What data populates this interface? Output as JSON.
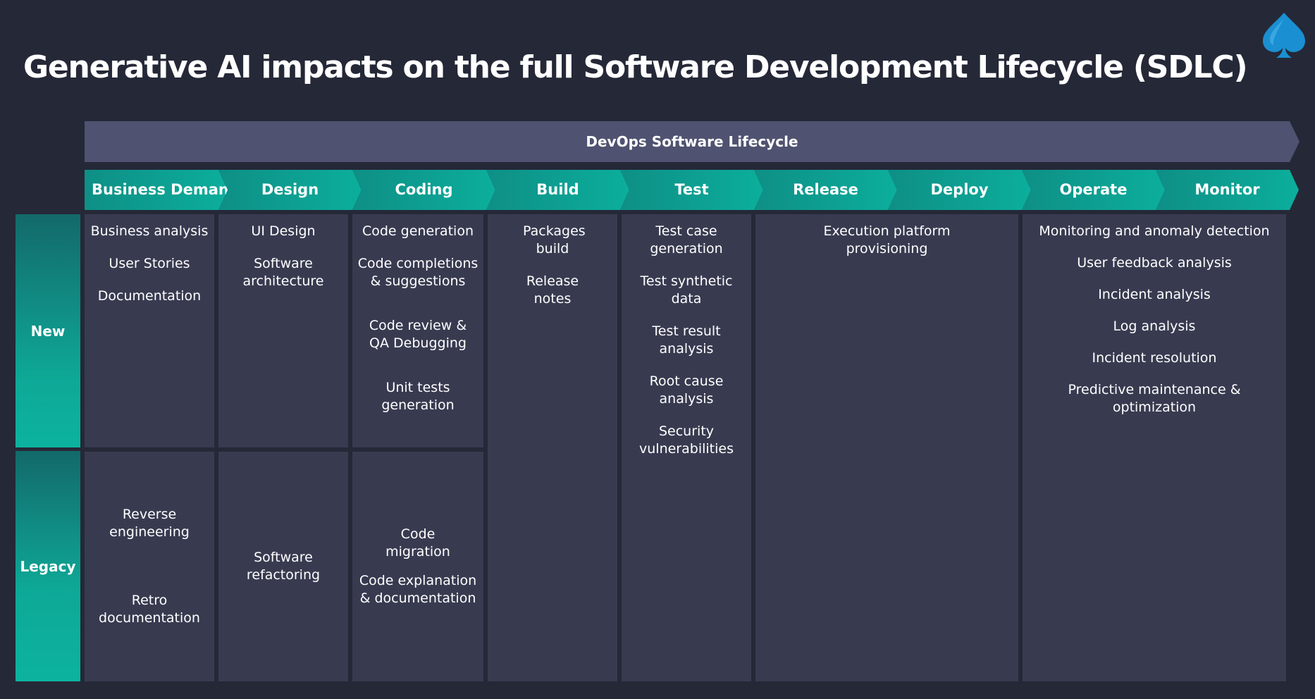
{
  "title": "Generative AI impacts on the full Software Development Lifecycle (SDLC)",
  "lifecycle_label": "DevOps Software Lifecycle",
  "phases": [
    "Business Demand",
    "Design",
    "Coding",
    "Build",
    "Test",
    "Release",
    "Deploy",
    "Operate",
    "Monitor"
  ],
  "rows": {
    "new": "New",
    "legacy": "Legacy"
  },
  "colors": {
    "background": "#252837",
    "cell": "#383b50",
    "banner": "#4f5270",
    "accent": "#0ea897",
    "logo": "#1a8fd1"
  },
  "icons": {
    "logo": "spade-logo-icon"
  },
  "new_cells": {
    "business_demand": [
      "Business analysis",
      "User Stories",
      "Documentation"
    ],
    "design": [
      "UI Design",
      "Software architecture"
    ],
    "coding": [
      "Code generation",
      "Code completions & suggestions",
      "Code review & QA Debugging",
      "Unit tests generation"
    ],
    "build": [
      "Packages build",
      "Release notes"
    ],
    "test": [
      "Test case generation",
      "Test synthetic data",
      "Test result analysis",
      "Root cause analysis",
      "Security vulnerabilities"
    ],
    "release_deploy": [
      "Execution platform provisioning"
    ],
    "operate_monitor": [
      "Monitoring and anomaly detection",
      "User feedback analysis",
      "Incident analysis",
      "Log analysis",
      "Incident resolution",
      "Predictive maintenance & optimization"
    ]
  },
  "legacy_cells": {
    "business_demand": [
      "Reverse engineering",
      "Retro documentation"
    ],
    "design": [
      "Software refactoring"
    ],
    "coding": [
      "Code migration",
      "Code explanation & documentation"
    ]
  }
}
